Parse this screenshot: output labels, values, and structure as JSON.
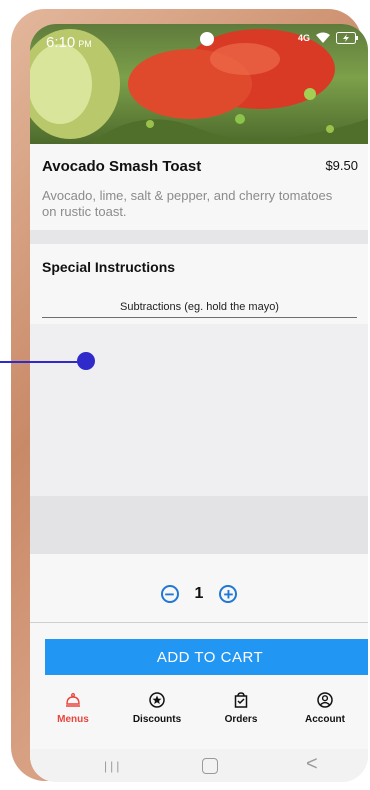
{
  "status_bar": {
    "time": "6:10",
    "ampm": "PM",
    "network": "4G"
  },
  "item": {
    "title": "Avocado Smash Toast",
    "price": "$9.50",
    "description": "Avocado, lime, salt & pepper, and cherry tomatoes on rustic toast."
  },
  "special_instructions": {
    "title": "Special Instructions",
    "placeholder": "Subtractions (eg. hold the mayo)"
  },
  "quantity": {
    "value": "1"
  },
  "add_to_cart": {
    "label": "ADD TO CART"
  },
  "tabs": [
    {
      "label": "Menus",
      "icon": "cloche-icon",
      "active": true
    },
    {
      "label": "Discounts",
      "icon": "star-badge-icon",
      "active": false
    },
    {
      "label": "Orders",
      "icon": "bag-check-icon",
      "active": false
    },
    {
      "label": "Account",
      "icon": "user-circle-icon",
      "active": false
    }
  ],
  "nav_bar": {
    "recents": "|||",
    "back": "<"
  },
  "colors": {
    "accent": "#2196f3",
    "active_tab": "#e8453c",
    "annotation": "#2f2ac9"
  }
}
